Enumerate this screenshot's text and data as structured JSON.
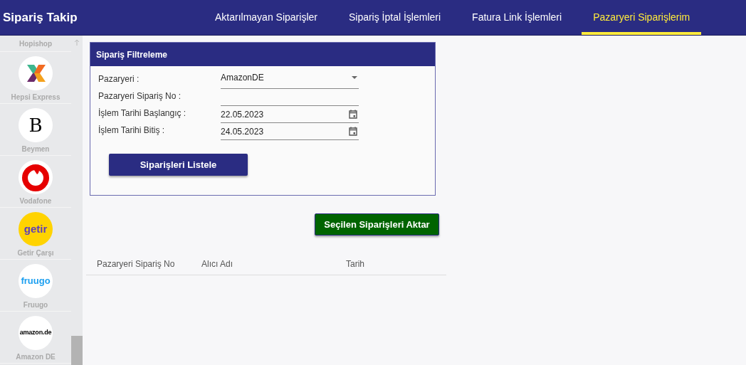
{
  "app_title": "Sipariş Takip",
  "tabs": [
    {
      "label": "Aktarılmayan Siparişler",
      "selected": false
    },
    {
      "label": "Sipariş İptal İşlemleri",
      "selected": false
    },
    {
      "label": "Fatura Link İşlemleri",
      "selected": false
    },
    {
      "label": "Pazaryeri Siparişlerim",
      "selected": true
    }
  ],
  "sidebar": {
    "items": [
      {
        "label": "Hopishop"
      },
      {
        "label": "Hepsi Express",
        "logo": {
          "kind": "hepsi"
        }
      },
      {
        "label": "Beymen",
        "logo": {
          "kind": "letter",
          "text": "B"
        }
      },
      {
        "label": "Vodafone",
        "logo": {
          "kind": "vodafone"
        }
      },
      {
        "label": "Getir Çarşı",
        "logo": {
          "kind": "getir",
          "text": "getir"
        }
      },
      {
        "label": "Fruugo",
        "logo": {
          "kind": "fruugo",
          "text": "fruugo"
        }
      },
      {
        "label": "Amazon DE",
        "logo": {
          "kind": "amazon",
          "text": "amazon.de"
        }
      }
    ]
  },
  "filter": {
    "title": "Sipariş Filtreleme",
    "fields": [
      {
        "label": "Pazaryeri :",
        "kind": "select",
        "value": "AmazonDE"
      },
      {
        "label": "Pazaryeri Sipariş No :",
        "kind": "text"
      },
      {
        "label": "İşlem Tarihi Başlangıç :",
        "kind": "date",
        "value": "22.05.2023"
      },
      {
        "label": "İşlem Tarihi Bitiş :",
        "kind": "date",
        "value": "24.05.2023"
      }
    ],
    "button": "Siparişleri Listele"
  },
  "transfer_button": "Seçilen Siparişleri Aktar",
  "table": {
    "columns": [
      "Pazaryeri Sipariş No",
      "Alıcı Adı",
      "Tarih"
    ]
  }
}
